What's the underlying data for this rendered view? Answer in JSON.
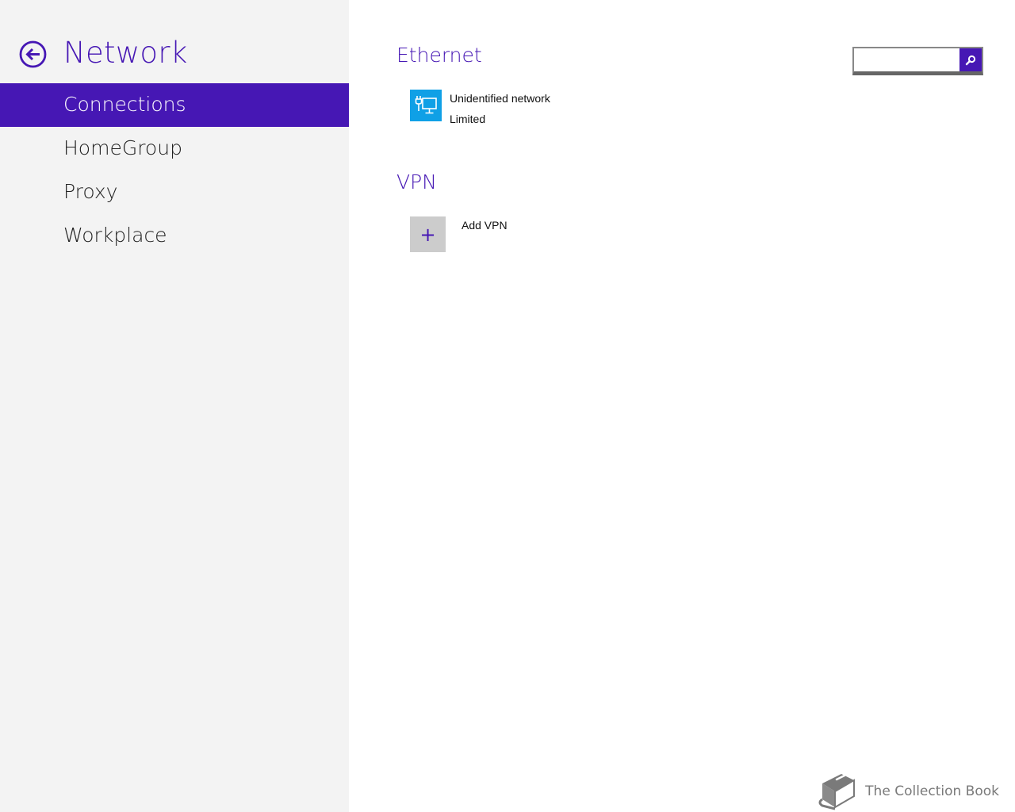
{
  "sidebar": {
    "title": "Network",
    "back_icon": "back-arrow-circle-icon",
    "items": [
      {
        "label": "Connections",
        "active": true
      },
      {
        "label": "HomeGroup",
        "active": false
      },
      {
        "label": "Proxy",
        "active": false
      },
      {
        "label": "Workplace",
        "active": false
      }
    ]
  },
  "main": {
    "ethernet": {
      "title": "Ethernet",
      "icon": "ethernet-monitor-icon",
      "network_name": "Unidentified network",
      "status": "Limited"
    },
    "vpn": {
      "title": "VPN",
      "icon": "plus-icon",
      "add_symbol": "+",
      "add_label": "Add VPN"
    },
    "search": {
      "value": "",
      "icon": "search-icon"
    }
  },
  "watermark": {
    "icon": "book-icon",
    "text": "The Collection Book"
  },
  "colors": {
    "accent": "#4617b4",
    "ethernet_tile": "#0fa0e6",
    "sidebar_bg": "#f3f3f3",
    "vpn_tile": "#cccccc"
  }
}
